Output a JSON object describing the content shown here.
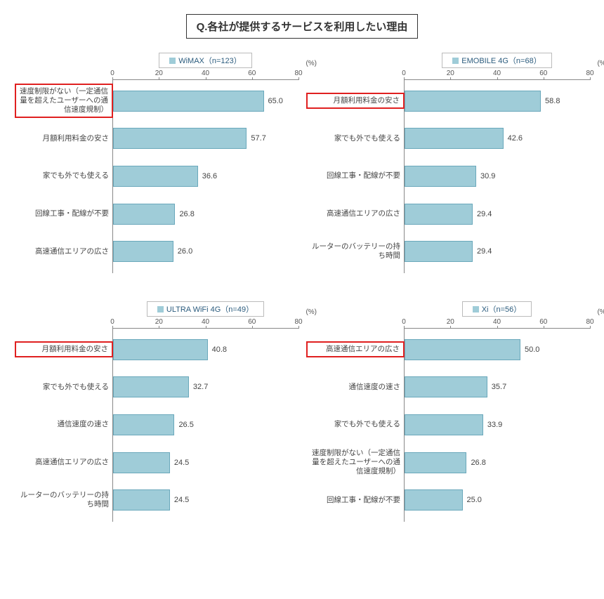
{
  "title": "Q.各社が提供するサービスを利用したい理由",
  "pct_label": "(%)",
  "ticks": [
    "0",
    "20",
    "40",
    "60",
    "80"
  ],
  "xmax": 80,
  "bar_color": "#9fccd8",
  "highlight_color": "#e02020",
  "charts": [
    {
      "legend": "WiMAX（n=123）",
      "rows": [
        {
          "label": "速度制限がない（一定通信量を超えたユーザーへの通信速度規制）",
          "value": 65.0,
          "highlight": true
        },
        {
          "label": "月額利用料金の安さ",
          "value": 57.7,
          "highlight": false
        },
        {
          "label": "家でも外でも使える",
          "value": 36.6,
          "highlight": false
        },
        {
          "label": "回線工事・配線が不要",
          "value": 26.8,
          "highlight": false
        },
        {
          "label": "高速通信エリアの広さ",
          "value": 26.0,
          "highlight": false
        }
      ]
    },
    {
      "legend": "EMOBILE 4G（n=68）",
      "rows": [
        {
          "label": "月額利用料金の安さ",
          "value": 58.8,
          "highlight": true
        },
        {
          "label": "家でも外でも使える",
          "value": 42.6,
          "highlight": false
        },
        {
          "label": "回線工事・配線が不要",
          "value": 30.9,
          "highlight": false
        },
        {
          "label": "高速通信エリアの広さ",
          "value": 29.4,
          "highlight": false
        },
        {
          "label": "ルーターのバッテリーの持ち時間",
          "value": 29.4,
          "highlight": false
        }
      ]
    },
    {
      "legend": "ULTRA WiFi 4G（n=49）",
      "rows": [
        {
          "label": "月額利用料金の安さ",
          "value": 40.8,
          "highlight": true
        },
        {
          "label": "家でも外でも使える",
          "value": 32.7,
          "highlight": false
        },
        {
          "label": "通信速度の速さ",
          "value": 26.5,
          "highlight": false
        },
        {
          "label": "高速通信エリアの広さ",
          "value": 24.5,
          "highlight": false
        },
        {
          "label": "ルーターのバッテリーの持ち時間",
          "value": 24.5,
          "highlight": false
        }
      ]
    },
    {
      "legend": "Xi（n=56）",
      "rows": [
        {
          "label": "高速通信エリアの広さ",
          "value": 50.0,
          "highlight": true
        },
        {
          "label": "通信速度の速さ",
          "value": 35.7,
          "highlight": false
        },
        {
          "label": "家でも外でも使える",
          "value": 33.9,
          "highlight": false
        },
        {
          "label": "速度制限がない（一定通信量を超えたユーザーへの通信速度規制）",
          "value": 26.8,
          "highlight": false
        },
        {
          "label": "回線工事・配線が不要",
          "value": 25.0,
          "highlight": false
        }
      ]
    }
  ],
  "chart_data": [
    {
      "type": "bar",
      "title": "WiMAX（n=123）",
      "xlabel": "(%)",
      "ylabel": "",
      "ylim": [
        0,
        80
      ],
      "categories": [
        "速度制限がない（一定通信量を超えたユーザーへの通信速度規制）",
        "月額利用料金の安さ",
        "家でも外でも使える",
        "回線工事・配線が不要",
        "高速通信エリアの広さ"
      ],
      "values": [
        65.0,
        57.7,
        36.6,
        26.8,
        26.0
      ]
    },
    {
      "type": "bar",
      "title": "EMOBILE 4G（n=68）",
      "xlabel": "(%)",
      "ylabel": "",
      "ylim": [
        0,
        80
      ],
      "categories": [
        "月額利用料金の安さ",
        "家でも外でも使える",
        "回線工事・配線が不要",
        "高速通信エリアの広さ",
        "ルーターのバッテリーの持ち時間"
      ],
      "values": [
        58.8,
        42.6,
        30.9,
        29.4,
        29.4
      ]
    },
    {
      "type": "bar",
      "title": "ULTRA WiFi 4G（n=49）",
      "xlabel": "(%)",
      "ylabel": "",
      "ylim": [
        0,
        80
      ],
      "categories": [
        "月額利用料金の安さ",
        "家でも外でも使える",
        "通信速度の速さ",
        "高速通信エリアの広さ",
        "ルーターのバッテリーの持ち時間"
      ],
      "values": [
        40.8,
        32.7,
        26.5,
        24.5,
        24.5
      ]
    },
    {
      "type": "bar",
      "title": "Xi（n=56）",
      "xlabel": "(%)",
      "ylabel": "",
      "ylim": [
        0,
        80
      ],
      "categories": [
        "高速通信エリアの広さ",
        "通信速度の速さ",
        "家でも外でも使える",
        "速度制限がない（一定通信量を超えたユーザーへの通信速度規制）",
        "回線工事・配線が不要"
      ],
      "values": [
        50.0,
        35.7,
        33.9,
        26.8,
        25.0
      ]
    }
  ]
}
